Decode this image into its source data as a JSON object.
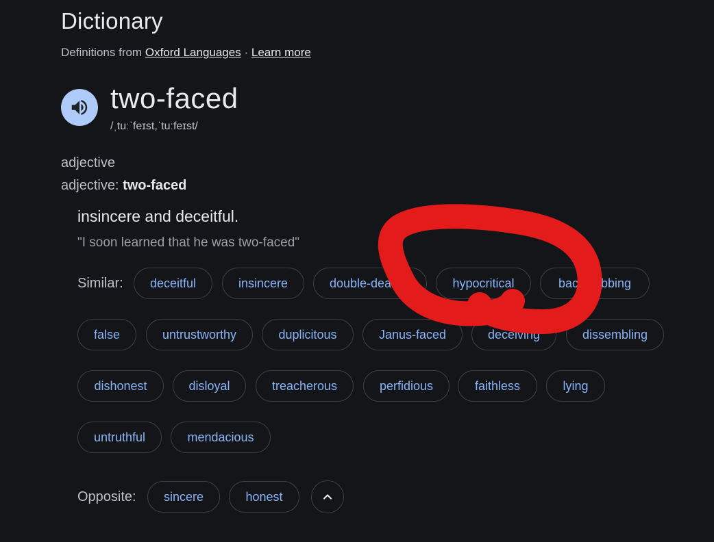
{
  "header": {
    "title": "Dictionary",
    "source_prefix": "Definitions from",
    "source_link": "Oxford Languages",
    "separator": "·",
    "learn_more": "Learn more"
  },
  "entry": {
    "word": "two-faced",
    "phonetic": "/ˌtuːˈfeɪst,ˈtuːfeɪst/",
    "pos": "adjective",
    "pos_prefix": "adjective:",
    "pos_word": "two-faced",
    "definition": "insincere and deceitful.",
    "example": "\"I soon learned that he was two-faced\""
  },
  "similar": {
    "label": "Similar:",
    "words": [
      "deceitful",
      "insincere",
      "double-dealing",
      "hypocritical",
      "backstabbing",
      "false",
      "untrustworthy",
      "duplicitous",
      "Janus-faced",
      "deceiving",
      "dissembling",
      "dishonest",
      "disloyal",
      "treacherous",
      "perfidious",
      "faithless",
      "lying",
      "untruthful",
      "mendacious"
    ]
  },
  "opposite": {
    "label": "Opposite:",
    "words": [
      "sincere",
      "honest"
    ]
  },
  "icons": {
    "speaker": "speaker-icon",
    "collapse": "chevron-up-icon"
  },
  "colors": {
    "background": "#141519",
    "chip_text": "#8ab4f8",
    "speaker_bg": "#aecbfa",
    "annotation": "#e31b1b"
  }
}
